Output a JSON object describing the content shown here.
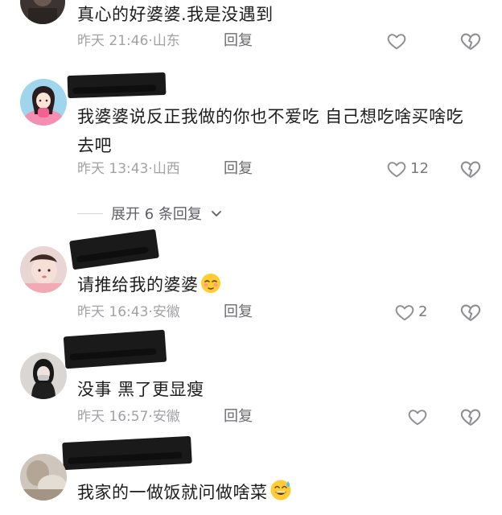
{
  "comments": [
    {
      "text": "真心的好婆婆.我是没遇到",
      "time": "昨天 21:46",
      "location": "山东",
      "reply_label": "回复",
      "likes": "",
      "avatar_icon": "dark-avatar"
    },
    {
      "text": "我婆婆说反正我做的你也不爱吃 自己想吃啥买啥吃去吧",
      "time": "昨天 13:43",
      "location": "山西",
      "reply_label": "回复",
      "likes": "12",
      "avatar_icon": "pink-anime-avatar"
    },
    {
      "text": "请推给我的婆婆",
      "time": "昨天 16:43",
      "location": "安徽",
      "reply_label": "回复",
      "likes": "2",
      "avatar_icon": "baby-photo-avatar",
      "emoji": "relieved-face-emoji"
    },
    {
      "text": "没事 黑了更显瘦",
      "time": "昨天 16:57",
      "location": "安徽",
      "reply_label": "回复",
      "likes": "",
      "avatar_icon": "girl-photo-avatar"
    },
    {
      "text": "我家的一做饭就问做啥菜",
      "time": "",
      "location": "",
      "reply_label": "",
      "likes": "",
      "avatar_icon": "blurred-photo-avatar",
      "emoji": "sweat-smile-emoji"
    }
  ],
  "expand_replies": {
    "label": "展开 6 条回复",
    "icon": "chevron-down-icon"
  },
  "colors": {
    "text": "#1d1d1f",
    "meta": "#a2a2a6",
    "reply": "#6b6b70",
    "icon": "#8e8e93"
  }
}
